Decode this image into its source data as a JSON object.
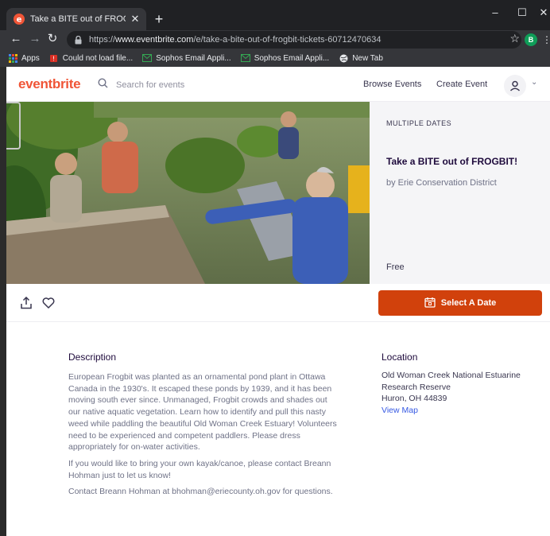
{
  "browser": {
    "tab_title": "Take a BITE out of FROGBIT! Ticke",
    "url_prefix": "https://",
    "url_host": "www.eventbrite.com",
    "url_path": "/e/take-a-bite-out-of-frogbit-tickets-60712470634",
    "profile_initial": "B",
    "bookmarks": [
      {
        "label": "Apps"
      },
      {
        "label": "Could not load file..."
      },
      {
        "label": "Sophos Email Appli..."
      },
      {
        "label": "Sophos Email Appli..."
      },
      {
        "label": "New Tab"
      }
    ]
  },
  "header": {
    "logo": "eventbrite",
    "search_placeholder": "Search for events",
    "browse_events": "Browse Events",
    "create_event": "Create Event"
  },
  "event": {
    "dates_label": "MULTIPLE DATES",
    "title": "Take a BITE out of FROGBIT!",
    "organizer": "by Erie Conservation District",
    "price": "Free",
    "cta": "Select A Date"
  },
  "description": {
    "heading": "Description",
    "paragraphs": [
      "European Frogbit was planted as an ornamental pond plant in Ottawa Canada in the 1930's. It escaped these ponds by 1939, and it has been moving south ever since. Unmanaged, Frogbit crowds and shades out our native aquatic vegetation. Learn how to identify and pull this nasty weed while paddling the beautiful Old Woman Creek Estuary! Volunteers need to be experienced and competent paddlers. Please dress appropriately for on-water activities.",
      "If you would like to bring your own kayak/canoe, please contact Breann Hohman just to let us know!",
      "Contact Breann Hohman at bhohman@eriecounty.oh.gov for questions."
    ]
  },
  "location": {
    "heading": "Location",
    "line1": "Old Woman Creek National Estuarine",
    "line2": "Research Reserve",
    "line3": "Huron, OH 44839",
    "map_link": "View Map"
  },
  "colors": {
    "brand": "#f05537",
    "cta": "#d1410c",
    "link": "#3659e3"
  }
}
